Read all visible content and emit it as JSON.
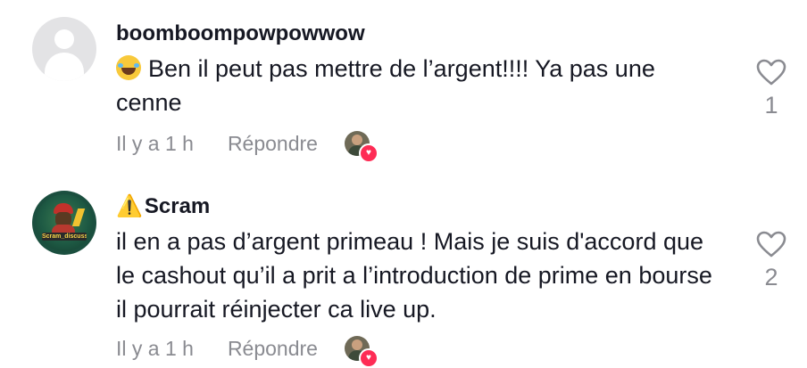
{
  "comments": [
    {
      "username": "boomboompowpowwow",
      "emoji": "😂",
      "text": "Ben il peut pas mettre de l’argent!!!! Ya pas une cenne",
      "time": "Il y a 1 h",
      "reply_label": "Répondre",
      "like_count": "1"
    },
    {
      "warning_icon": "⚠️",
      "username": "Scram",
      "avatar_tag": "Scram_discuss",
      "text": "il en a pas d’argent primeau ! Mais je suis d'accord que le cashout qu’il a prit a l’introduction de prime en bourse il pourrait réinjecter ca live up.",
      "time": "Il y a 1 h",
      "reply_label": "Répondre",
      "like_count": "2"
    }
  ],
  "colors": {
    "text": "#161823",
    "meta": "#8a8b91",
    "heart_badge": "#fe2c55"
  }
}
